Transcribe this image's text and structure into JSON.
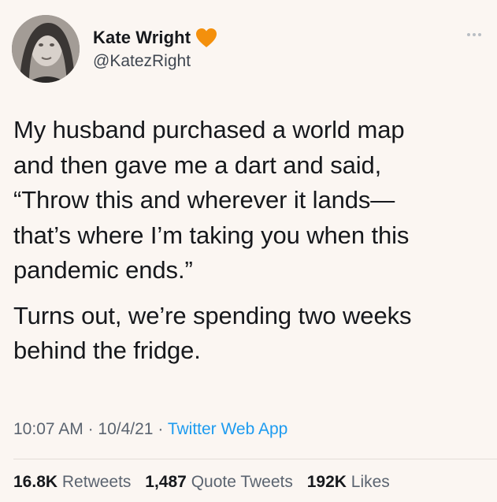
{
  "author": {
    "display_name": "Kate Wright",
    "handle": "@KatezRight",
    "badge_icon": "orange-heart-icon",
    "badge_color": "#f4900c",
    "avatar_icon": "profile-photo"
  },
  "menu_icon": "more-options-icon",
  "tweet": {
    "paragraph_1_lines": [
      "My husband purchased a world map",
      "and then gave me a dart and said,",
      "“Throw this and wherever it lands—",
      "that’s where I’m taking you when this",
      "pandemic ends.”"
    ],
    "paragraph_2_lines": [
      "Turns out, we’re spending two weeks",
      "behind the fridge."
    ]
  },
  "meta": {
    "time": "10:07 AM",
    "separator": "·",
    "date": "10/4/21",
    "source": "Twitter Web App",
    "source_color": "#1d9bf0"
  },
  "stats": {
    "retweets_count": "16.8K",
    "retweets_label": "Retweets",
    "quote_tweets_count": "1,487",
    "quote_tweets_label": "Quote Tweets",
    "likes_count": "192K",
    "likes_label": "Likes"
  }
}
